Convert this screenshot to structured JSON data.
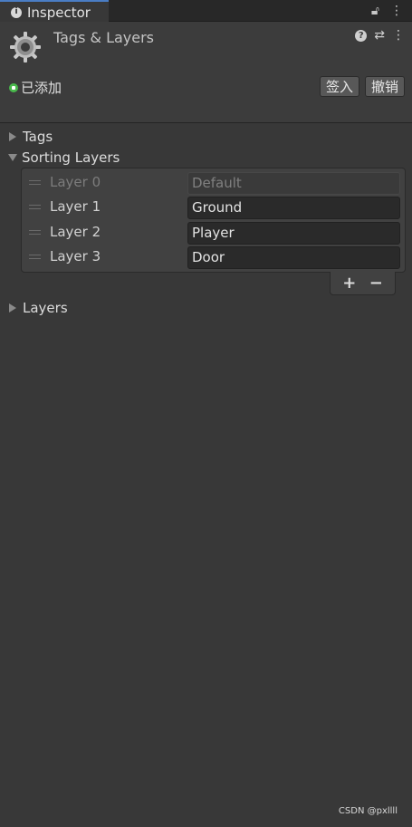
{
  "tab": {
    "title": "Inspector"
  },
  "header": {
    "title": "Tags & Layers"
  },
  "version_control": {
    "status": "已添加",
    "checkin_label": "签入",
    "revert_label": "撤销"
  },
  "sections": {
    "tags": "Tags",
    "sorting_layers": "Sorting Layers",
    "layers": "Layers"
  },
  "sorting_layers": [
    {
      "label": "Layer 0",
      "value": "Default",
      "disabled": true
    },
    {
      "label": "Layer 1",
      "value": "Ground",
      "disabled": false
    },
    {
      "label": "Layer 2",
      "value": "Player",
      "disabled": false
    },
    {
      "label": "Layer 3",
      "value": "Door",
      "disabled": false
    }
  ],
  "list_footer": {
    "add": "+",
    "remove": "−"
  },
  "watermark": "CSDN @pxllll",
  "colors": {
    "accent": "#4a7dc4",
    "status": "#49b94c",
    "background": "#383838"
  }
}
